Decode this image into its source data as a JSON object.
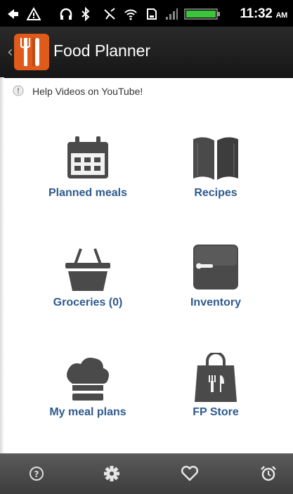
{
  "status_bar": {
    "time": "11:32",
    "ampm": "AM"
  },
  "header": {
    "title": "Food Planner"
  },
  "help": {
    "text": "Help Videos on YouTube!"
  },
  "tiles": [
    {
      "label": "Planned meals",
      "icon": "calendar-icon"
    },
    {
      "label": "Recipes",
      "icon": "book-icon"
    },
    {
      "label": "Groceries (0)",
      "icon": "basket-icon"
    },
    {
      "label": "Inventory",
      "icon": "cabinet-icon"
    },
    {
      "label": "My meal plans",
      "icon": "chef-hat-icon"
    },
    {
      "label": "FP Store",
      "icon": "store-bag-icon"
    }
  ],
  "bottom_nav": [
    {
      "icon": "help-icon"
    },
    {
      "icon": "settings-icon"
    },
    {
      "icon": "heart-icon"
    },
    {
      "icon": "alarm-icon"
    }
  ],
  "colors": {
    "label_blue": "#2e5a8e",
    "icon_gray": "#4a4a4a",
    "logo_orange": "#e05a1c",
    "battery_green": "#3cc43c"
  }
}
